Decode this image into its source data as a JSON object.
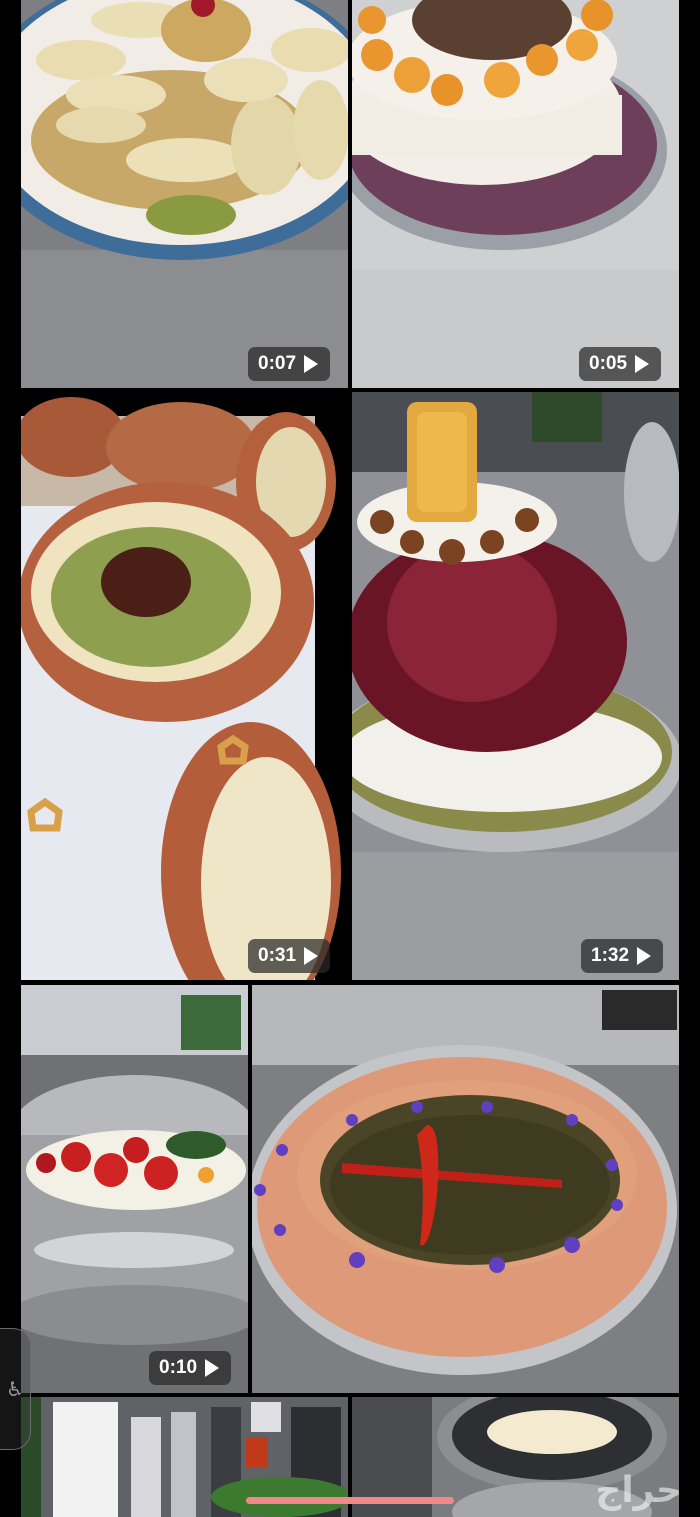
{
  "grid": {
    "videos": [
      {
        "id": "v1",
        "duration": "0:07",
        "subject": "qatayef-kunafa-platter"
      },
      {
        "id": "v2",
        "duration": "0:05",
        "subject": "apricot-cream-cake"
      },
      {
        "id": "v3",
        "duration": "0:31",
        "subject": "clay-pot-pudding"
      },
      {
        "id": "v4",
        "duration": "1:32",
        "subject": "beet-dome-dessert"
      },
      {
        "id": "v5",
        "duration": "0:10",
        "subject": "tomato-salad-pot"
      },
      {
        "id": "v6",
        "duration": "",
        "subject": "saloona-tray"
      },
      {
        "id": "v7",
        "duration": "",
        "subject": "kitchen-counter"
      },
      {
        "id": "v8",
        "duration": "",
        "subject": "mixing-bowl"
      }
    ]
  },
  "watermark": "حراج",
  "accessibility_icon": "accessibility-icon",
  "colors": {
    "background": "#000000",
    "scroll_indicator": "#f08a8a"
  }
}
